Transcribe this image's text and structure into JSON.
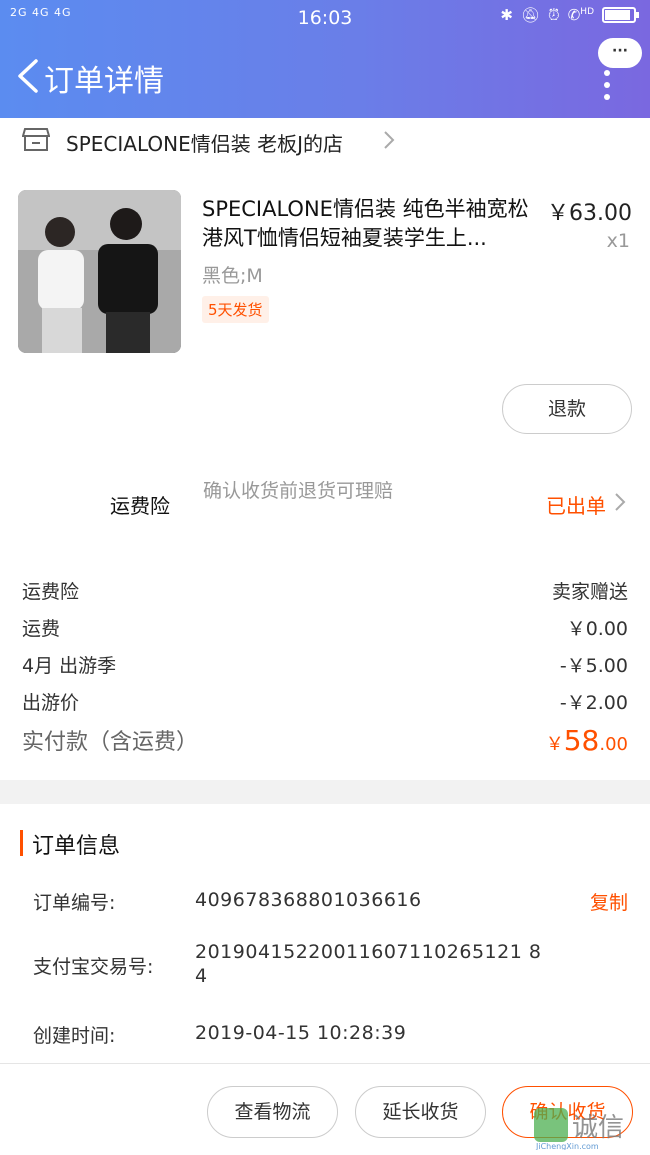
{
  "status_bar": {
    "signal_text": "2G 4G 4G",
    "time": "16:03",
    "hd": "HD",
    "battery_percent": 90
  },
  "nav": {
    "back_icon": "chevron-left-icon",
    "title": "订单详情",
    "more_button": "···"
  },
  "shop": {
    "icon": "store-icon",
    "name": "SPECIALONE情侣装 老板J的店"
  },
  "product": {
    "title": "SPECIALONE情侣装 纯色半袖宽松港风T恤情侣短袖夏装学生上...",
    "price": "￥63.00",
    "quantity": "x1",
    "sku": "黑色;M",
    "shipping_tag": "5天发货",
    "refund_button": "退款"
  },
  "insurance": {
    "label": "运费险",
    "description": "确认收货前退货可理赔",
    "status": "已出单"
  },
  "fees": [
    {
      "label": "运费险",
      "value": "卖家赠送"
    },
    {
      "label": "运费",
      "value": "￥0.00"
    },
    {
      "label": "4月 出游季",
      "value": "-￥5.00"
    },
    {
      "label": "出游价",
      "value": "-￥2.00"
    }
  ],
  "total": {
    "label": "实付款（含运费）",
    "currency": "￥",
    "integer": "58",
    "decimal": ".00"
  },
  "order_info": {
    "title": "订单信息",
    "order_no_label": "订单编号:",
    "order_no": "409678368801036616",
    "copy": "复制",
    "alipay_label": "支付宝交易号:",
    "alipay_no": "20190415220011607110265121 84",
    "created_label": "创建时间:",
    "created": "2019-04-15 10:28:39"
  },
  "actions": {
    "logistics": "查看物流",
    "extend": "延长收货",
    "confirm": "确认收货"
  },
  "watermark": {
    "text": "集诚信",
    "sub": "JiChengXin.com"
  },
  "colors": {
    "accent": "#ff5000",
    "header_start": "#5b8cf0",
    "header_end": "#7a68e0"
  }
}
